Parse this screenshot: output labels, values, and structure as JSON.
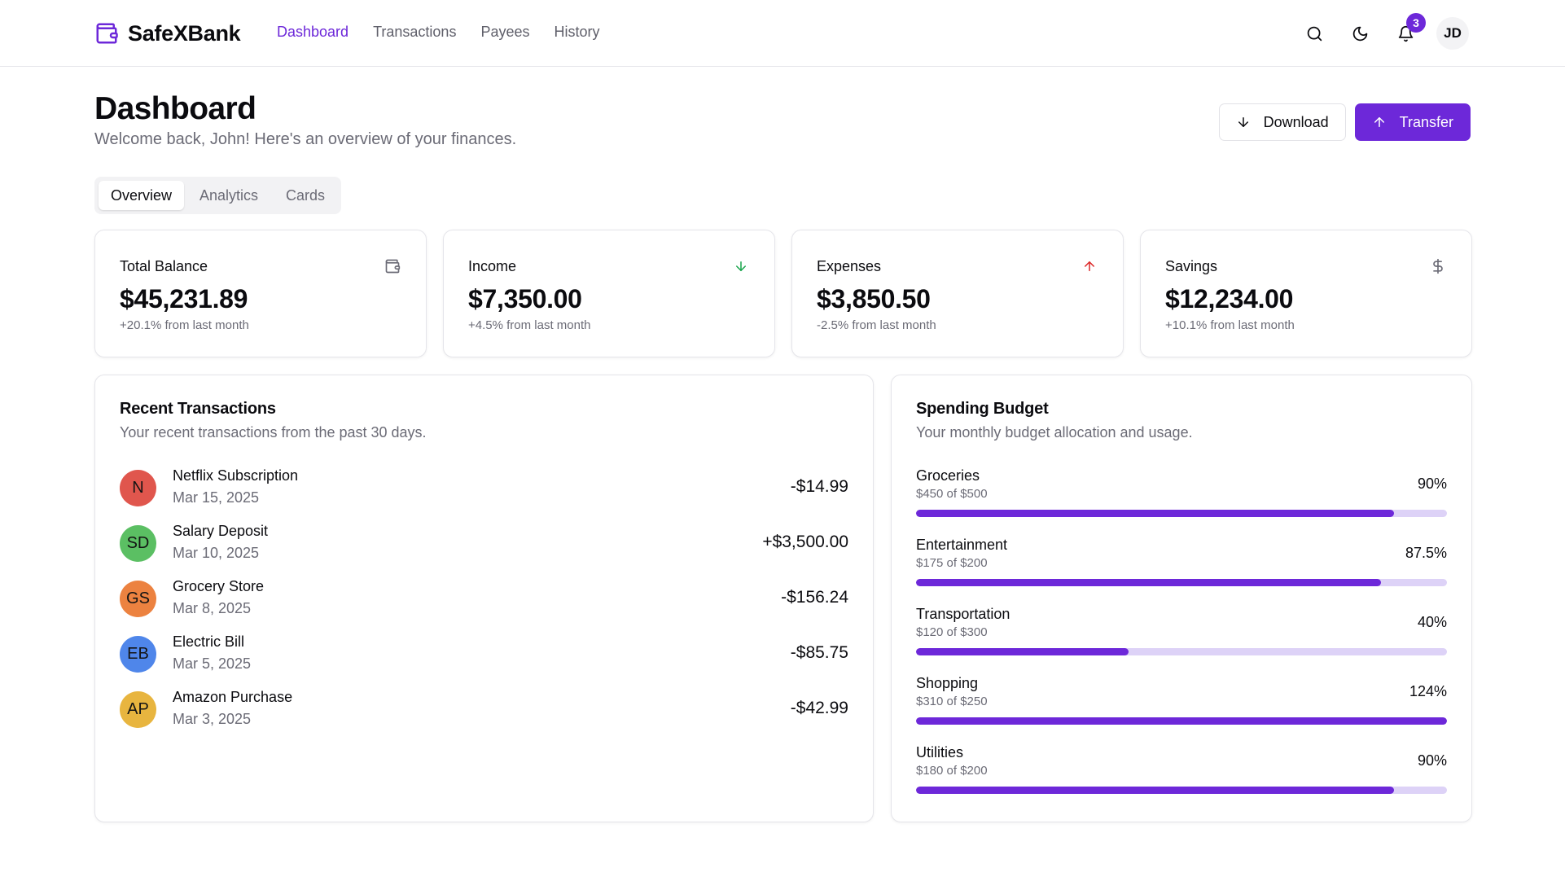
{
  "brand": {
    "name": "SafeXBank"
  },
  "nav": {
    "links": [
      {
        "label": "Dashboard",
        "active": true
      },
      {
        "label": "Transactions",
        "active": false
      },
      {
        "label": "Payees",
        "active": false
      },
      {
        "label": "History",
        "active": false
      }
    ],
    "notification_count": "3",
    "user_initials": "JD"
  },
  "header": {
    "title": "Dashboard",
    "subtitle": "Welcome back, John! Here's an overview of your finances.",
    "download_label": "Download",
    "transfer_label": "Transfer"
  },
  "tabs": [
    {
      "label": "Overview",
      "active": true
    },
    {
      "label": "Analytics",
      "active": false
    },
    {
      "label": "Cards",
      "active": false
    }
  ],
  "stats": [
    {
      "label": "Total Balance",
      "value": "$45,231.89",
      "change": "+20.1% from last month",
      "icon": "wallet-icon"
    },
    {
      "label": "Income",
      "value": "$7,350.00",
      "change": "+4.5% from last month",
      "icon": "arrow-down-icon"
    },
    {
      "label": "Expenses",
      "value": "$3,850.50",
      "change": "-2.5% from last month",
      "icon": "arrow-up-icon"
    },
    {
      "label": "Savings",
      "value": "$12,234.00",
      "change": "+10.1% from last month",
      "icon": "dollar-icon"
    }
  ],
  "transactions": {
    "title": "Recent Transactions",
    "description": "Your recent transactions from the past 30 days.",
    "items": [
      {
        "initials": "N",
        "name": "Netflix Subscription",
        "date": "Mar 15, 2025",
        "amount": "-$14.99",
        "color": "#e0564d"
      },
      {
        "initials": "SD",
        "name": "Salary Deposit",
        "date": "Mar 10, 2025",
        "amount": "+$3,500.00",
        "color": "#5bbf63"
      },
      {
        "initials": "GS",
        "name": "Grocery Store",
        "date": "Mar 8, 2025",
        "amount": "-$156.24",
        "color": "#ec8240"
      },
      {
        "initials": "EB",
        "name": "Electric Bill",
        "date": "Mar 5, 2025",
        "amount": "-$85.75",
        "color": "#4f86ea"
      },
      {
        "initials": "AP",
        "name": "Amazon Purchase",
        "date": "Mar 3, 2025",
        "amount": "-$42.99",
        "color": "#e8b53f"
      }
    ]
  },
  "budget": {
    "title": "Spending Budget",
    "description": "Your monthly budget allocation and usage.",
    "items": [
      {
        "name": "Groceries",
        "spent": "$450 of $500",
        "percent": "90%",
        "fraction": 0.9
      },
      {
        "name": "Entertainment",
        "spent": "$175 of $200",
        "percent": "87.5%",
        "fraction": 0.875
      },
      {
        "name": "Transportation",
        "spent": "$120 of $300",
        "percent": "40%",
        "fraction": 0.4
      },
      {
        "name": "Shopping",
        "spent": "$310 of $250",
        "percent": "124%",
        "fraction": 1.0
      },
      {
        "name": "Utilities",
        "spent": "$180 of $200",
        "percent": "90%",
        "fraction": 0.9
      }
    ]
  },
  "colors": {
    "accent": "#6d28d9",
    "accent_light": "#ddd2f7",
    "income_green": "#16a34a",
    "expense_red": "#dc2626"
  }
}
